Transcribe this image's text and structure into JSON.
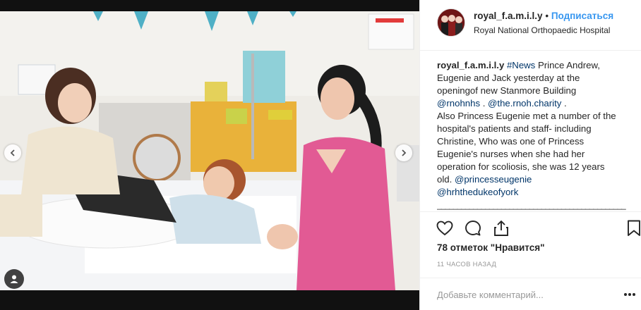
{
  "header": {
    "username": "royal_f.a.m.i.l.y",
    "separator": "•",
    "follow_label": "Подписаться",
    "location": "Royal National Orthopaedic Hospital"
  },
  "caption": {
    "username": "royal_f.a.m.i.l.y",
    "hashtag": "#News",
    "line1": " Prince Andrew,",
    "line2": "Eugenie and Jack yesterday at the",
    "line3": "openingof new Stanmore Building",
    "mention1": "@rnohnhs",
    "between": " . ",
    "mention2": "@the.rnoh.charity",
    "after": " .",
    "line5": "Also Princess Eugenie met a number of the",
    "line6": "hospital's patients and staff- including",
    "line7": "Christine, Who was one of Princess",
    "line8": "Eugenie's nurses when she had her",
    "line9": "operation for scoliosis, she was 12 years",
    "line10_prefix": "old. ",
    "mention3": "@princesseugenie",
    "mention4": "@hrhthedukeofyork",
    "separator_line": "_______________________________________________"
  },
  "actions": {
    "like_icon": "heart-icon",
    "comment_icon": "comment-icon",
    "share_icon": "share-icon",
    "save_icon": "bookmark-icon"
  },
  "likes_text": "78 отметок \"Нравится\"",
  "time_ago": "11 ЧАСОВ НАЗАД",
  "comment": {
    "placeholder": "Добавьте комментарий...",
    "more_icon": "more-options-icon"
  },
  "media": {
    "prev_icon": "chevron-left-icon",
    "next_icon": "chevron-right-icon",
    "tag_icon": "user-tag-icon"
  },
  "colors": {
    "follow": "#3897f0",
    "link": "#003569",
    "muted": "#999999",
    "border": "#efefef"
  }
}
